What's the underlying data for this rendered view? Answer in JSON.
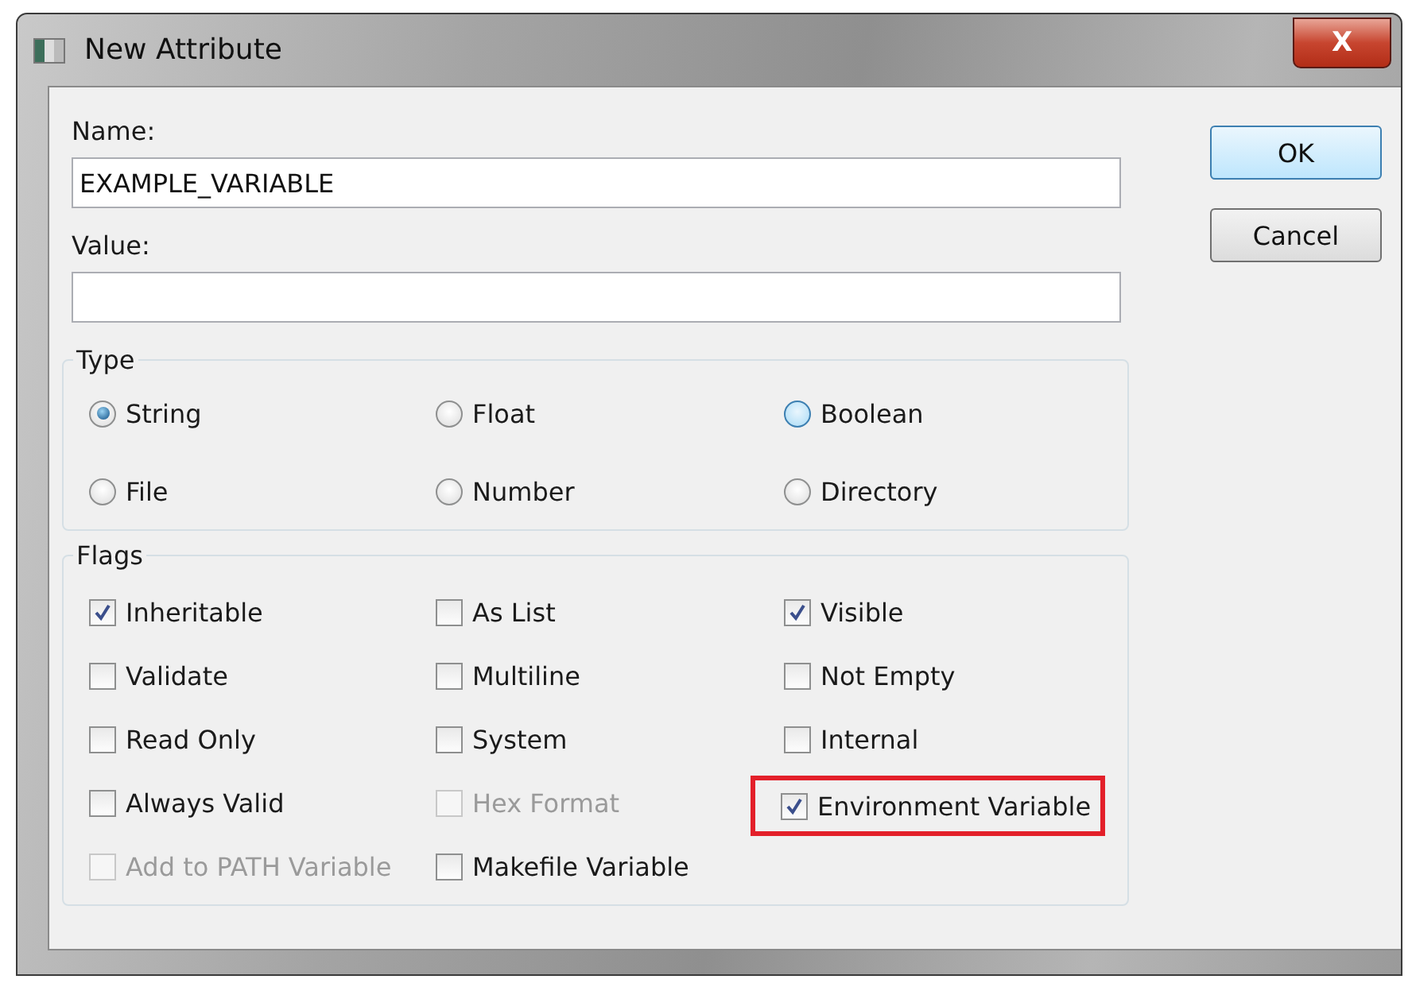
{
  "window": {
    "title": "New Attribute",
    "close_label": "X"
  },
  "fields": [
    {
      "label": "Name:",
      "value": "EXAMPLE_VARIABLE"
    },
    {
      "label": "Value:"
    }
  ],
  "buttons": [
    {
      "label": "OK",
      "default": true
    },
    {
      "label": "Cancel",
      "default": false
    }
  ],
  "type_group": {
    "title": "Type",
    "options": [
      {
        "label": "String",
        "selected": true,
        "hovered": false
      },
      {
        "label": "Float",
        "selected": false,
        "hovered": false
      },
      {
        "label": "Boolean",
        "selected": false,
        "hovered": true
      },
      {
        "label": "File",
        "selected": false,
        "hovered": false
      },
      {
        "label": "Number",
        "selected": false,
        "hovered": false
      },
      {
        "label": "Directory",
        "selected": false,
        "hovered": false
      }
    ]
  },
  "flags_group": {
    "title": "Flags",
    "options": [
      {
        "label": "Inheritable",
        "checked": true,
        "disabled": false,
        "highlighted": false
      },
      {
        "label": "As List",
        "checked": false,
        "disabled": false,
        "highlighted": false
      },
      {
        "label": "Visible",
        "checked": true,
        "disabled": false,
        "highlighted": false
      },
      {
        "label": "Validate",
        "checked": false,
        "disabled": false,
        "highlighted": false
      },
      {
        "label": "Multiline",
        "checked": false,
        "disabled": false,
        "highlighted": false
      },
      {
        "label": "Not Empty",
        "checked": false,
        "disabled": false,
        "highlighted": false
      },
      {
        "label": "Read Only",
        "checked": false,
        "disabled": false,
        "highlighted": false
      },
      {
        "label": "System",
        "checked": false,
        "disabled": false,
        "highlighted": false
      },
      {
        "label": "Internal",
        "checked": false,
        "disabled": false,
        "highlighted": false
      },
      {
        "label": "Always Valid",
        "checked": false,
        "disabled": false,
        "highlighted": false
      },
      {
        "label": "Hex Format",
        "checked": false,
        "disabled": true,
        "highlighted": false
      },
      {
        "label": "Environment Variable",
        "checked": true,
        "disabled": false,
        "highlighted": true
      },
      {
        "label": "Add to PATH Variable",
        "checked": false,
        "disabled": true,
        "highlighted": false
      },
      {
        "label": "Makefile Variable",
        "checked": false,
        "disabled": false,
        "highlighted": false
      }
    ]
  }
}
